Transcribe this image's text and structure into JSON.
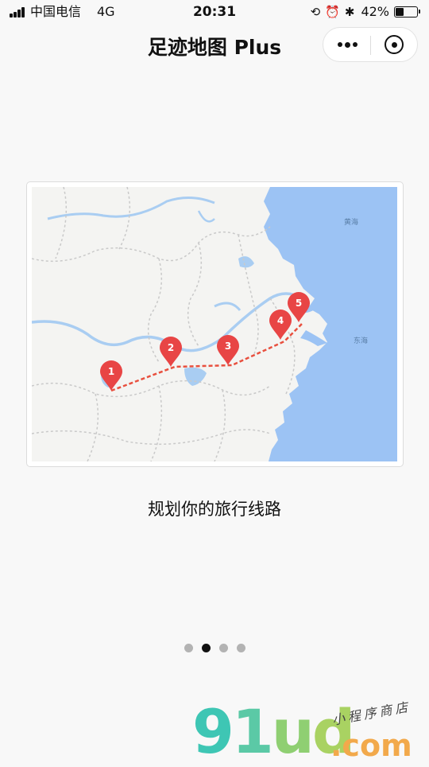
{
  "status_bar": {
    "carrier": "中国电信",
    "network": "4G",
    "time": "20:31",
    "battery_percent": 42,
    "battery_label": "42%",
    "icons": [
      "orientation-lock-icon",
      "alarm-icon",
      "bluetooth-icon"
    ]
  },
  "nav": {
    "title": "足迹地图 Plus",
    "more_icon": "more-dots-icon",
    "close_icon": "target-close-icon"
  },
  "map": {
    "sea_labels": [
      "黄海",
      "东海"
    ],
    "markers": [
      {
        "label": "1"
      },
      {
        "label": "2"
      },
      {
        "label": "3"
      },
      {
        "label": "4"
      },
      {
        "label": "5"
      }
    ],
    "colors": {
      "sea": "#9cc3f4",
      "land": "#f4f4f2",
      "river": "#a9cdf2",
      "route": "#e8503f",
      "marker": "#e84545"
    }
  },
  "caption": "规划你的旅行线路",
  "pager": {
    "count": 4,
    "active_index": 1
  },
  "watermark": {
    "brand": "91ud",
    "suffix": ".com",
    "tagline": "小程序商店"
  }
}
